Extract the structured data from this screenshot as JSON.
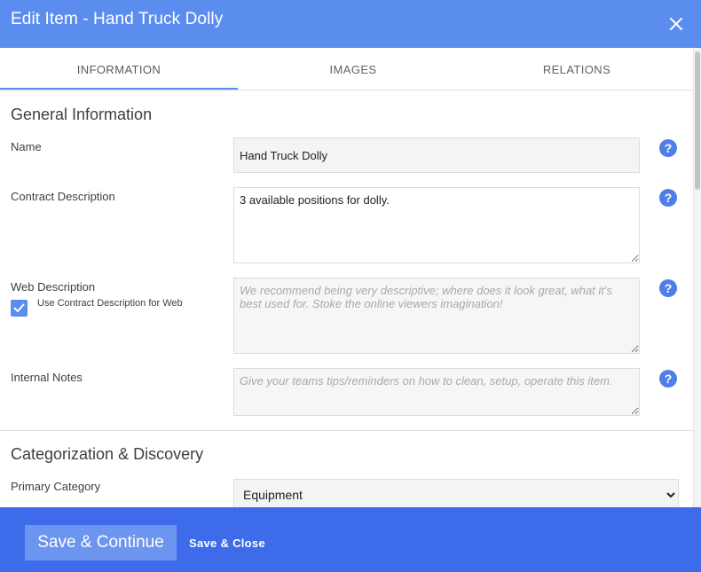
{
  "dialog": {
    "title": "Edit Item - Hand Truck Dolly",
    "close_icon": "close-icon"
  },
  "tabs": [
    {
      "label": "INFORMATION",
      "active": true
    },
    {
      "label": "IMAGES",
      "active": false
    },
    {
      "label": "RELATIONS",
      "active": false
    }
  ],
  "general": {
    "heading": "General Information",
    "name": {
      "label": "Name",
      "value": "Hand Truck Dolly"
    },
    "contract_description": {
      "label": "Contract Description",
      "value": "3 available positions for dolly."
    },
    "web_description": {
      "label": "Web Description",
      "checkbox_label": "Use Contract Description for Web",
      "checked": true,
      "placeholder": "We recommend being very descriptive; where does it look great, what it's best used for. Stoke the online viewers imagination!"
    },
    "internal_notes": {
      "label": "Internal Notes",
      "placeholder": "Give your teams tips/reminders on how to clean, setup, operate this item."
    },
    "help_glyph": "?"
  },
  "categorization": {
    "heading": "Categorization & Discovery",
    "primary_category": {
      "label": "Primary Category",
      "selected": "Equipment"
    }
  },
  "footer": {
    "save_continue": "Save & Continue",
    "save_close": "Save & Close"
  },
  "colors": {
    "titlebar": "#5b8def",
    "footer": "#3d6bea",
    "help": "#4f7fe6"
  }
}
